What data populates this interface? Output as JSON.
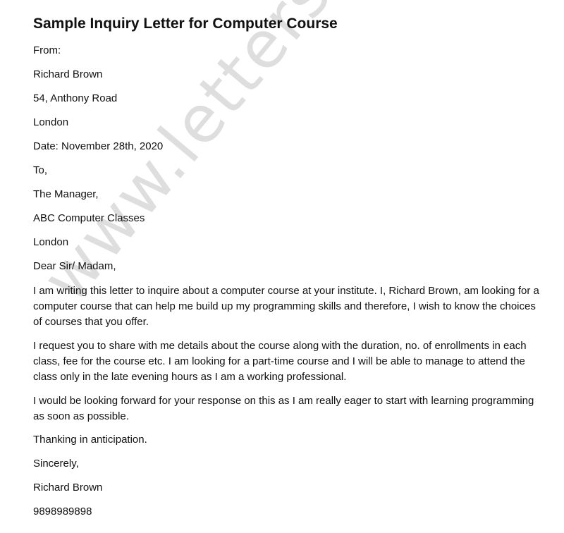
{
  "title": "Sample Inquiry Letter for Computer Course",
  "watermark": "www.lettersfree.com",
  "sender": {
    "from_label": "From:",
    "name": "Richard Brown",
    "address": "54, Anthony Road",
    "city": "London",
    "date": "Date: November 28th, 2020"
  },
  "recipient": {
    "to_label": "To,",
    "title": "The Manager,",
    "organization": "ABC Computer Classes",
    "city": "London"
  },
  "salutation": "Dear Sir/ Madam,",
  "paragraphs": [
    "I am writing this letter to inquire about a computer course at your institute. I, Richard Brown, am looking for a computer course that can help me build up my programming skills and therefore, I wish to know the choices of courses that you offer.",
    "I request you to share with me details about the course along with the duration, no. of enrollments in each class, fee for the course etc. I am looking for a part-time course and I will be able to manage to attend the class only in the late evening hours as I am a working professional.",
    "I would be looking forward for your response on this as I am really eager to start with learning programming as soon as possible."
  ],
  "closing": {
    "thanks": "Thanking in anticipation.",
    "sign_off": "Sincerely,",
    "name": "Richard Brown",
    "phone": "9898989898"
  }
}
